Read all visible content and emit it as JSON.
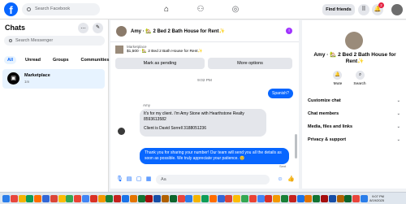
{
  "topbar": {
    "logo": "f",
    "search_placeholder": "Search Facebook",
    "find_friends": "Find friends",
    "notif_count": "2"
  },
  "left": {
    "title": "Chats",
    "search_placeholder": "Search Messenger",
    "tabs": [
      "All",
      "Unread",
      "Groups",
      "Communities"
    ],
    "conversation": {
      "name": "Marketplace",
      "time": "1m"
    }
  },
  "chat": {
    "title": "Amy · 🏡 2 Bed 2 Bath House for Rent✨",
    "listing_label": "Marketplace",
    "listing_price": "$1,500 · 🏡 2 Bed 2 Bath House for Rent✨",
    "mark_pending": "Mark as pending",
    "more_options": "More options",
    "timestamp": "9:02 PM",
    "msg_spanish": "Spanish?",
    "sender": "Amy",
    "msg_amy_1": "It's for my client.  I'm Amy Stone with Hearthstone Realty 8593613582",
    "msg_amy_2": "Client is David Sorrell 3188051236",
    "msg_reply": "Thank you for sharing your number!      Our team will send you all the details as soon as possible. We truly appreciate your patience. 😊",
    "sent": "Sent",
    "input_placeholder": "Aa"
  },
  "right": {
    "name": "Amy · 🏡 2 Bed 2 Bath House for Rent✨",
    "mute": "Mute",
    "search": "Search",
    "rows": [
      "Customize chat",
      "Chat members",
      "Media, files and links",
      "Privacy & support"
    ]
  },
  "taskbar": {
    "time": "9:07 PM",
    "date": "8/19/2025",
    "icon_colors": [
      "#2b7de9",
      "#e8453c",
      "#f4b400",
      "#0f9d58",
      "#ff6d00",
      "#3367d6",
      "#db4437",
      "#fbbc05",
      "#34a853",
      "#ea4335",
      "#4285f4",
      "#d93025",
      "#f29900",
      "#188038",
      "#c5221f",
      "#1a73e8",
      "#e37400",
      "#137333",
      "#a50e0e",
      "#174ea6",
      "#b06000",
      "#0d652d",
      "#e8453c",
      "#2b7de9",
      "#f4b400",
      "#0f9d58",
      "#ff6d00",
      "#3367d6",
      "#db4437",
      "#fbbc05",
      "#34a853",
      "#ea4335",
      "#4285f4",
      "#d93025",
      "#f29900",
      "#188038",
      "#c5221f",
      "#1a73e8",
      "#e37400",
      "#137333",
      "#a50e0e",
      "#174ea6",
      "#b06000",
      "#0d652d",
      "#e8453c",
      "#2b7de9"
    ]
  }
}
